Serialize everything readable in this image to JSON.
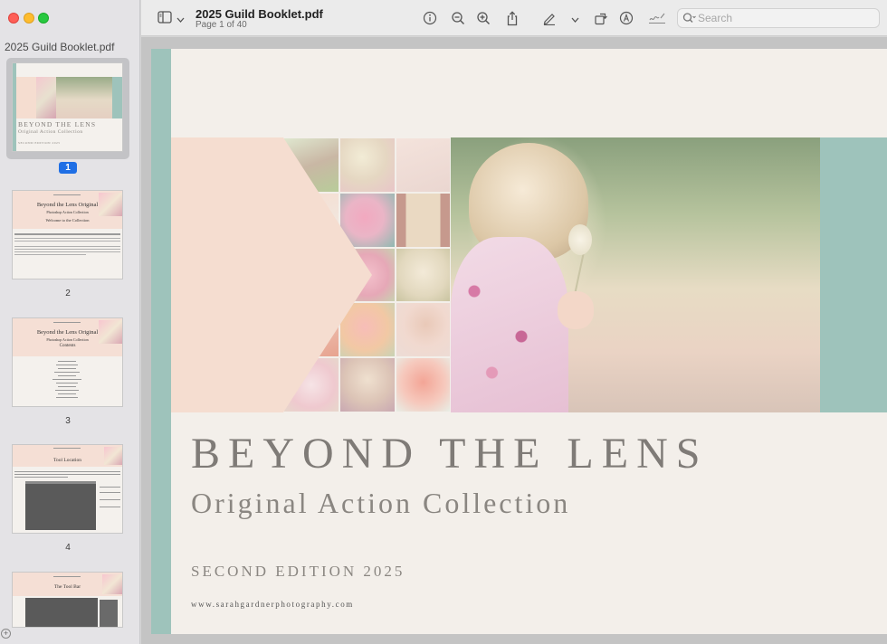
{
  "window": {
    "title": "2025 Guild Booklet.pdf",
    "page_indicator": "Page 1 of 40"
  },
  "sidebar": {
    "title": "2025 Guild Booklet.pdf",
    "thumbnails": [
      {
        "page": "1",
        "selected": true,
        "title": "BEYOND THE LENS",
        "subtitle": "Original Action Collection",
        "note": "SECOND EDITION 2025"
      },
      {
        "page": "2",
        "selected": false,
        "title": "Beyond the Lens Original",
        "subtitle": "Photoshop Action Collection",
        "heading": "Welcome to the Collection"
      },
      {
        "page": "3",
        "selected": false,
        "title": "Beyond the Lens Original",
        "subtitle": "Photoshop Action Collection",
        "heading": "Contents"
      },
      {
        "page": "4",
        "selected": false,
        "heading": "Tool Location"
      },
      {
        "page": "5",
        "selected": false,
        "heading": "The Tool Bar"
      }
    ]
  },
  "toolbar": {
    "icons": [
      "sidebar-toggle-icon",
      "chevron-down-icon",
      "info-icon",
      "zoom-out-icon",
      "zoom-in-icon",
      "share-icon",
      "highlight-pen-icon",
      "chevron-down-icon",
      "rotate-icon",
      "markup-icon",
      "sign-icon",
      "search-icon"
    ],
    "search": {
      "placeholder": "Search",
      "value": ""
    }
  },
  "document": {
    "title": "BEYOND THE LENS",
    "subtitle": "Original Action Collection",
    "edition": "SECOND EDITION 2025",
    "website": "www.sarahgardnerphotography.com",
    "colors": {
      "teal": "#9ec3bb",
      "blush": "#f5ddd0",
      "paper": "#f3efea",
      "title_text": "#7f7b77"
    }
  },
  "colors": {
    "selection": "#1f6fe5",
    "sidebar_bg": "#e4e3e6",
    "toolbar_bg": "#ebebeb"
  }
}
